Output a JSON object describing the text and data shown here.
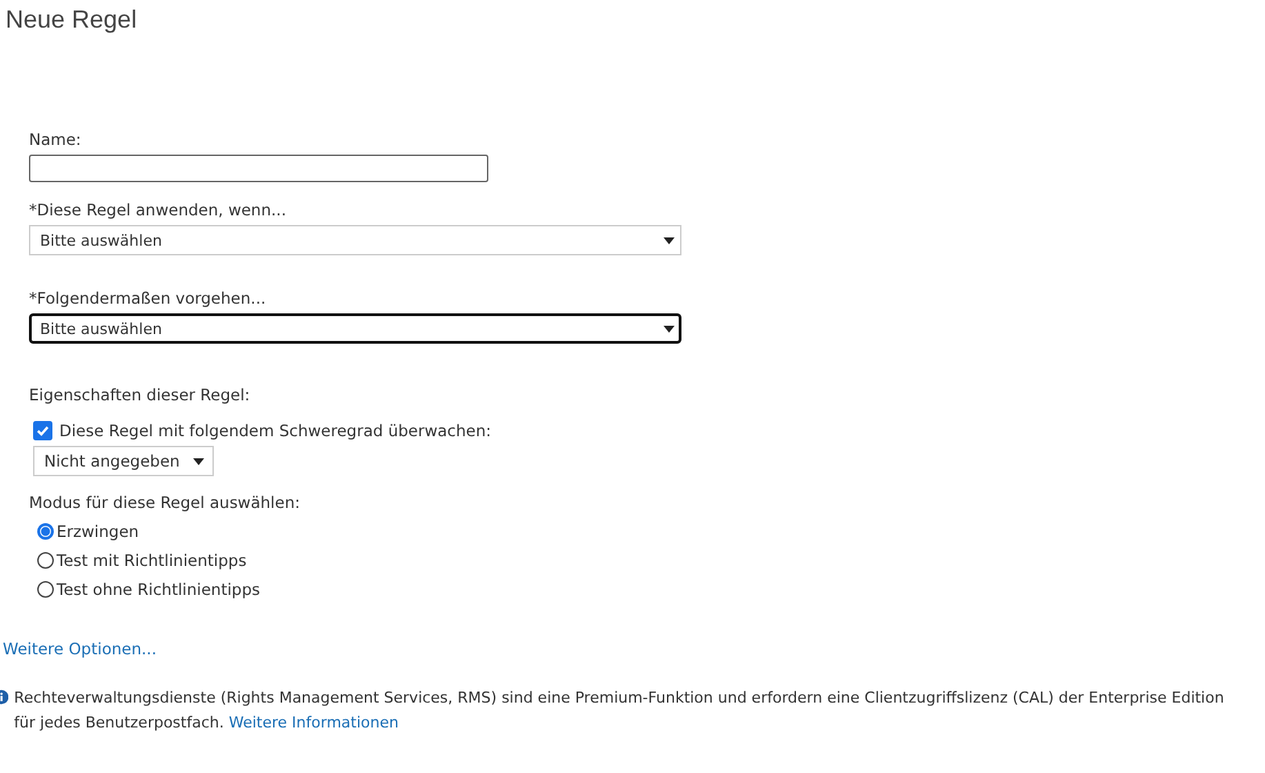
{
  "title": "Neue Regel",
  "name_field": {
    "label": "Name:"
  },
  "dropdowns": [
    {
      "label": "*Diese Regel anwenden, wenn...",
      "value": "Bitte auswählen",
      "focused": false
    },
    {
      "label": "*Folgendermaßen vorgehen...",
      "value": "Bitte auswählen",
      "focused": true
    }
  ],
  "properties": {
    "heading": "Eigenschaften dieser Regel:",
    "audit": {
      "label": "Diese Regel mit folgendem Schweregrad überwachen:",
      "checked": true
    },
    "severity": "Nicht angegeben"
  },
  "mode": {
    "heading": "Modus für diese Regel auswählen:",
    "options": [
      {
        "label": "Erzwingen",
        "selected": true
      },
      {
        "label": "Test mit Richtlinientipps",
        "selected": false
      },
      {
        "label": "Test ohne Richtlinientipps",
        "selected": false
      }
    ]
  },
  "more_options": "Weitere Optionen...",
  "note": {
    "text": "Rechteverwaltungsdienste (Rights Management Services, RMS) sind eine Premium-Funktion und erfordern eine Clientzugriffslizenz (CAL) der Enterprise Edition für jedes Benutzerpostfach.",
    "link": "Weitere Informationen"
  }
}
